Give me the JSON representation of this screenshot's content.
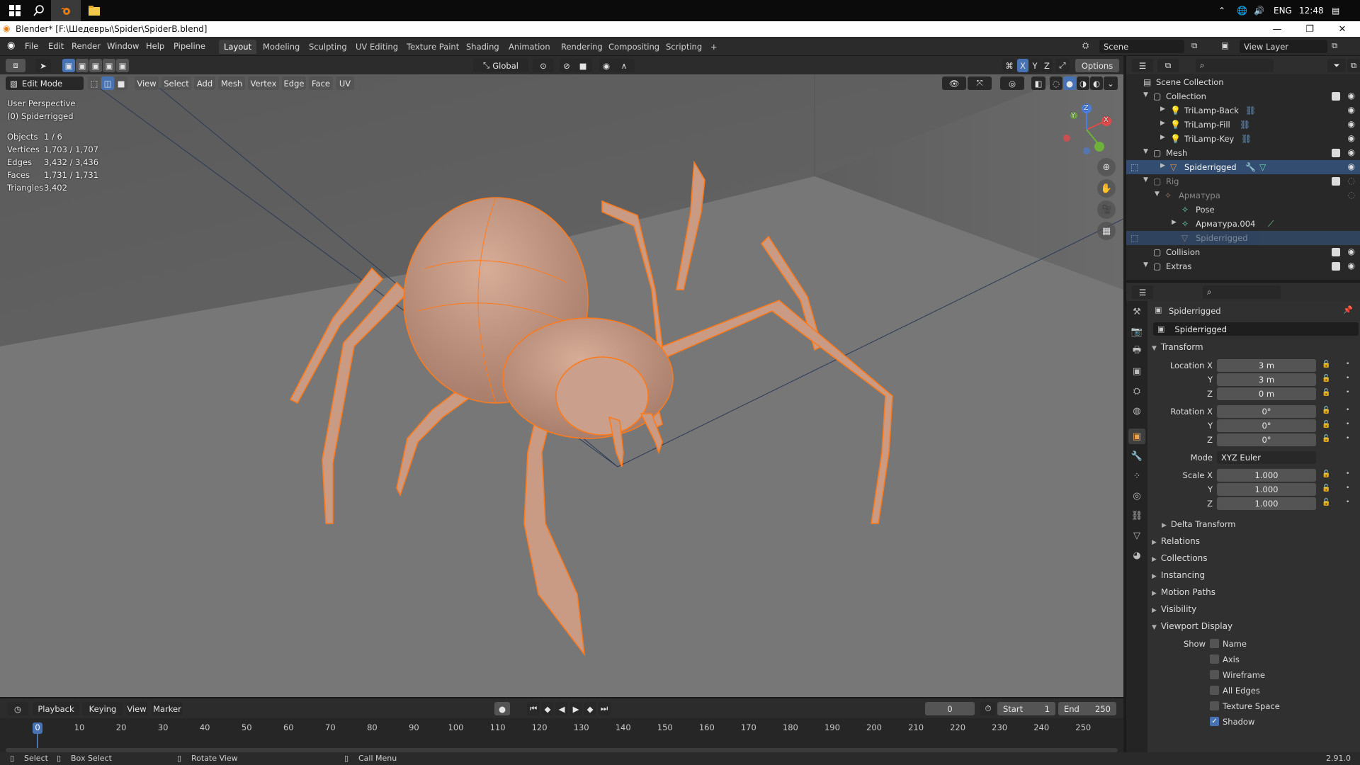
{
  "taskbar": {
    "windows_icon": "windows-logo-icon",
    "search_icon": "search-icon",
    "tray_lang": "ENG",
    "tray_time": "12:48"
  },
  "window": {
    "title": "Blender* [F:\\Шедевры\\Spider\\SpiderB.blend]"
  },
  "menu": [
    "File",
    "Edit",
    "Render",
    "Window",
    "Help",
    "Pipeline"
  ],
  "workspaces": [
    "Layout",
    "Modeling",
    "Sculpting",
    "UV Editing",
    "Texture Paint",
    "Shading",
    "Animation",
    "Rendering",
    "Compositing",
    "Scripting"
  ],
  "add_workspace": "+",
  "scene": {
    "label": "Scene",
    "view_layer": "View Layer"
  },
  "viewport": {
    "transform_orientation": "Global",
    "options_label": "Options",
    "mode": "Edit Mode",
    "header_menus": [
      "View",
      "Select",
      "Add",
      "Mesh",
      "Vertex",
      "Edge",
      "Face",
      "UV"
    ],
    "axis_x": "X",
    "axis_y": "Y",
    "axis_z": "Z",
    "perspective": "User Perspective",
    "object_name": "(0) Spiderrigged",
    "stats": [
      {
        "label": "Objects",
        "value": "1 / 6"
      },
      {
        "label": "Vertices",
        "value": "1,703 / 1,707"
      },
      {
        "label": "Edges",
        "value": "3,432 / 3,436"
      },
      {
        "label": "Faces",
        "value": "1,731 / 1,731"
      },
      {
        "label": "Triangles",
        "value": "3,402"
      }
    ],
    "gizmo": {
      "x": "X",
      "y": "Y",
      "z": "Z"
    }
  },
  "timeline": {
    "playback": "Playback",
    "keying": "Keying",
    "view": "View",
    "marker": "Marker",
    "current_frame": "0",
    "start_label": "Start",
    "start": "1",
    "end_label": "End",
    "end": "250",
    "ticks": [
      "0",
      "10",
      "20",
      "30",
      "40",
      "50",
      "60",
      "70",
      "80",
      "90",
      "100",
      "110",
      "120",
      "130",
      "140",
      "150",
      "160",
      "170",
      "180",
      "190",
      "200",
      "210",
      "220",
      "230",
      "240",
      "250"
    ]
  },
  "status": {
    "select": "Select",
    "box_select": "Box Select",
    "rotate_view": "Rotate View",
    "call_menu": "Call Menu",
    "version": "2.91.0"
  },
  "outliner": {
    "rows": [
      {
        "label": "Scene Collection"
      },
      {
        "label": "Collection"
      },
      {
        "label": "TriLamp-Back"
      },
      {
        "label": "TriLamp-Fill"
      },
      {
        "label": "TriLamp-Key"
      },
      {
        "label": "Mesh"
      },
      {
        "label": "Spiderrigged"
      },
      {
        "label": "Rig"
      },
      {
        "label": "Арматура"
      },
      {
        "label": "Pose"
      },
      {
        "label": "Арматура.004"
      },
      {
        "label": "Spiderrigged"
      },
      {
        "label": "Collision"
      },
      {
        "label": "Extras"
      }
    ]
  },
  "properties": {
    "object_name": "Spiderrigged",
    "object_field": "Spiderrigged",
    "transform_header": "Transform",
    "location_label": "Location X",
    "location": [
      "3 m",
      "3 m",
      "0 m"
    ],
    "rotation_label": "Rotation X",
    "rotation": [
      "0°",
      "0°",
      "0°"
    ],
    "mode_label": "Mode",
    "mode_value": "XYZ Euler",
    "scale_label": "Scale X",
    "scale": [
      "1.000",
      "1.000",
      "1.000"
    ],
    "y_label": "Y",
    "z_label": "Z",
    "panels": [
      "Delta Transform",
      "Relations",
      "Collections",
      "Instancing",
      "Motion Paths",
      "Visibility",
      "Viewport Display"
    ],
    "show_label": "Show",
    "show_options": [
      {
        "label": "Name",
        "checked": false
      },
      {
        "label": "Axis",
        "checked": false
      },
      {
        "label": "Wireframe",
        "checked": false
      },
      {
        "label": "All Edges",
        "checked": false
      },
      {
        "label": "Texture Space",
        "checked": false
      },
      {
        "label": "Shadow",
        "checked": true
      }
    ]
  }
}
